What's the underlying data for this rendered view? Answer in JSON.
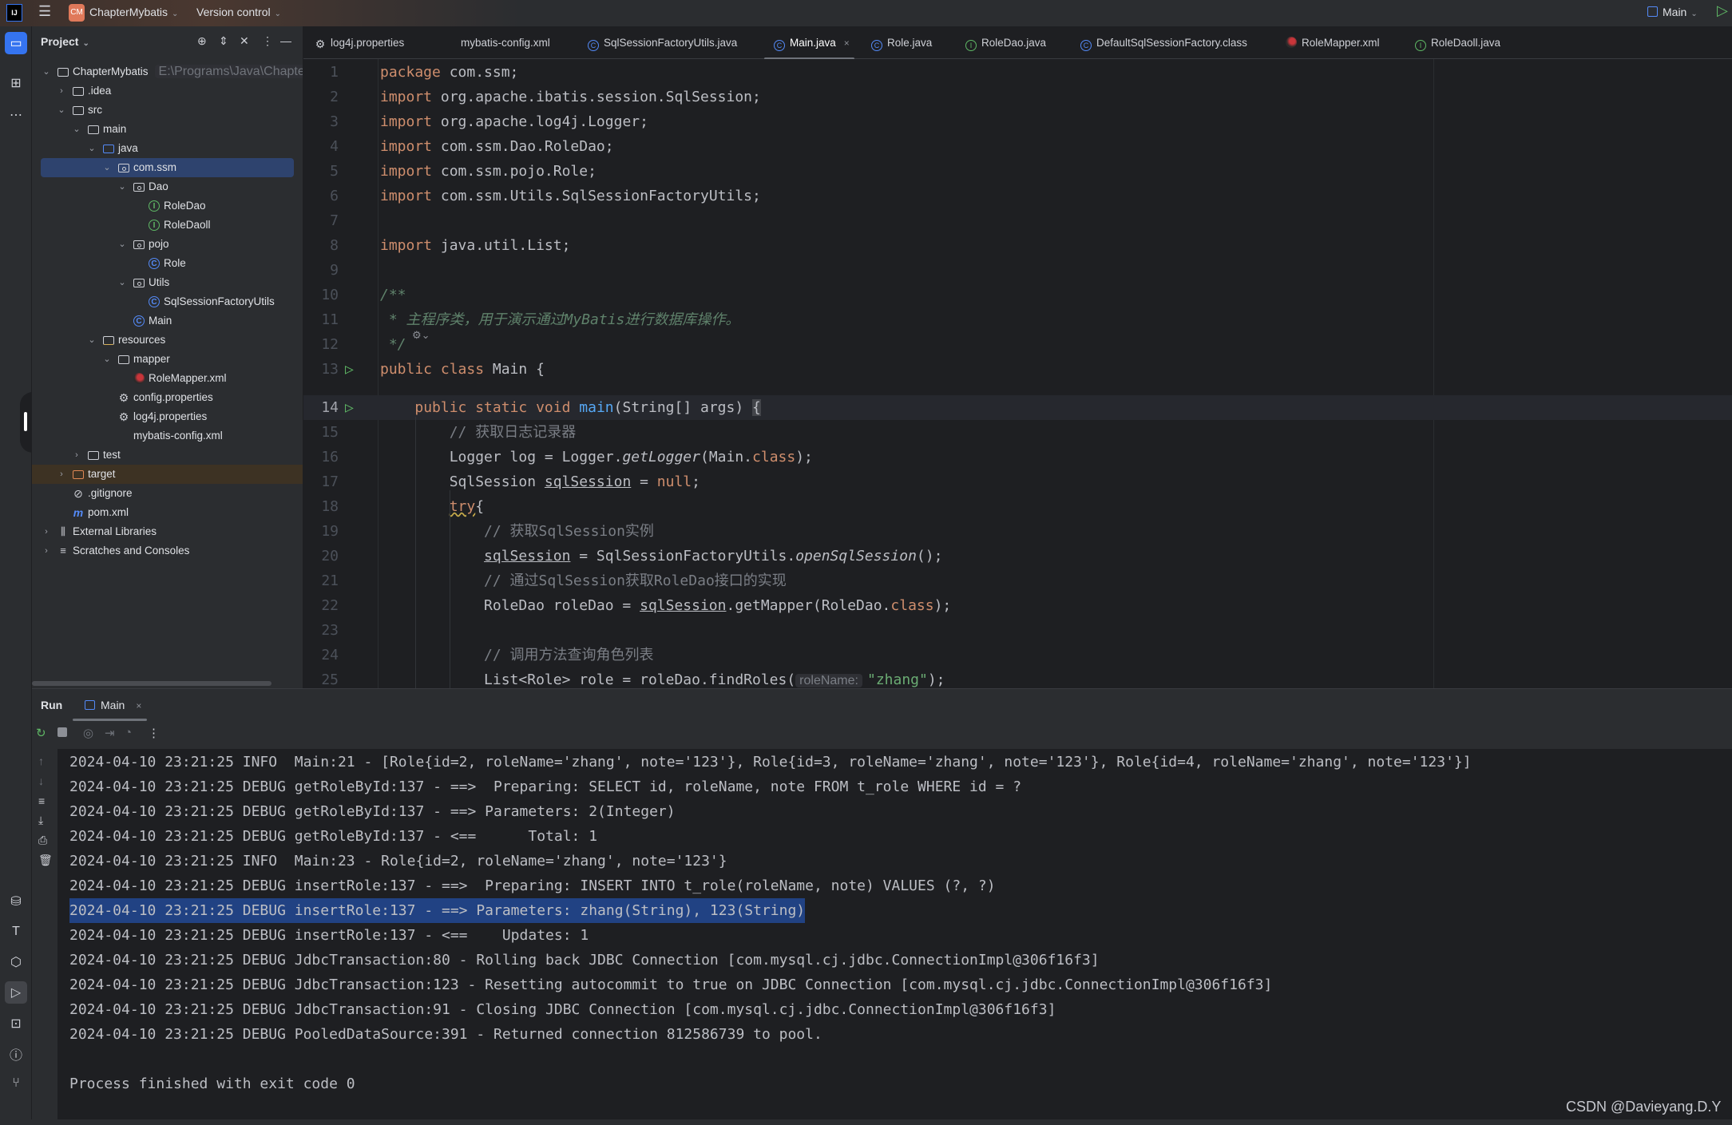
{
  "titlebar": {
    "app_logo": "IJ",
    "project_badge": "CM",
    "project_name": "ChapterMybatis",
    "vcs": "Version control",
    "run_config": "Main",
    "badge_color": "#e0795a"
  },
  "project_panel": {
    "title": "Project",
    "tree": [
      {
        "label": "ChapterMybatis",
        "hint": "E:\\Programs\\Java\\ChapterMy",
        "level": 0,
        "icon": "module-folder",
        "state": "expanded"
      },
      {
        "label": ".idea",
        "level": 1,
        "icon": "folder",
        "state": "collapsed"
      },
      {
        "label": "src",
        "level": 1,
        "icon": "folder",
        "state": "expanded"
      },
      {
        "label": "main",
        "level": 2,
        "icon": "folder",
        "state": "expanded"
      },
      {
        "label": "java",
        "level": 3,
        "icon": "source-folder",
        "state": "expanded"
      },
      {
        "label": "com.ssm",
        "level": 4,
        "icon": "package",
        "state": "expanded",
        "selected": true
      },
      {
        "label": "Dao",
        "level": 5,
        "icon": "package",
        "state": "expanded"
      },
      {
        "label": "RoleDao",
        "level": 6,
        "icon": "interface"
      },
      {
        "label": "RoleDaoll",
        "level": 6,
        "icon": "interface"
      },
      {
        "label": "pojo",
        "level": 5,
        "icon": "package",
        "state": "expanded"
      },
      {
        "label": "Role",
        "level": 6,
        "icon": "class"
      },
      {
        "label": "Utils",
        "level": 5,
        "icon": "package",
        "state": "expanded"
      },
      {
        "label": "SqlSessionFactoryUtils",
        "level": 6,
        "icon": "class"
      },
      {
        "label": "Main",
        "level": 5,
        "icon": "class"
      },
      {
        "label": "resources",
        "level": 3,
        "icon": "resources-folder",
        "state": "expanded"
      },
      {
        "label": "mapper",
        "level": 4,
        "icon": "folder",
        "state": "expanded"
      },
      {
        "label": "RoleMapper.xml",
        "level": 5,
        "icon": "mybatis"
      },
      {
        "label": "config.properties",
        "level": 4,
        "icon": "gear"
      },
      {
        "label": "log4j.properties",
        "level": 4,
        "icon": "gear"
      },
      {
        "label": "mybatis-config.xml",
        "level": 4,
        "icon": "xml"
      },
      {
        "label": "test",
        "level": 2,
        "icon": "folder",
        "state": "collapsed"
      },
      {
        "label": "target",
        "level": 1,
        "icon": "excluded-folder",
        "state": "collapsed",
        "highlighted": true
      },
      {
        "label": ".gitignore",
        "level": 1,
        "icon": "ignore"
      },
      {
        "label": "pom.xml",
        "level": 1,
        "icon": "maven"
      },
      {
        "label": "External Libraries",
        "level": 0,
        "icon": "library",
        "state": "collapsed"
      },
      {
        "label": "Scratches and Consoles",
        "level": 0,
        "icon": "scratches",
        "state": "collapsed"
      }
    ]
  },
  "tabs": [
    {
      "label": "log4j.properties",
      "icon": "gear"
    },
    {
      "label": "mybatis-config.xml",
      "icon": "xml"
    },
    {
      "label": "SqlSessionFactoryUtils.java",
      "icon": "class"
    },
    {
      "label": "Main.java",
      "icon": "class",
      "active": true,
      "close": "×"
    },
    {
      "label": "Role.java",
      "icon": "class"
    },
    {
      "label": "RoleDao.java",
      "icon": "interface"
    },
    {
      "label": "DefaultSqlSessionFactory.class",
      "icon": "class"
    },
    {
      "label": "RoleMapper.xml",
      "icon": "mybatis"
    },
    {
      "label": "RoleDaoll.java",
      "icon": "interface"
    }
  ],
  "editor": {
    "current_line": 14,
    "run_gutter_lines": [
      13,
      14
    ],
    "lines": [
      {
        "n": "1",
        "tokens": [
          {
            "t": "package",
            "c": "kw"
          },
          {
            "t": " com.ssm;"
          }
        ]
      },
      {
        "n": "2",
        "tokens": [
          {
            "t": "import",
            "c": "kw"
          },
          {
            "t": " org.apache.ibatis.session.SqlSession;"
          }
        ]
      },
      {
        "n": "3",
        "tokens": [
          {
            "t": "import",
            "c": "kw"
          },
          {
            "t": " org.apache.log4j.Logger;"
          }
        ]
      },
      {
        "n": "4",
        "tokens": [
          {
            "t": "import",
            "c": "kw"
          },
          {
            "t": " com.ssm.Dao.RoleDao;"
          }
        ]
      },
      {
        "n": "5",
        "tokens": [
          {
            "t": "import",
            "c": "kw"
          },
          {
            "t": " com.ssm.pojo.Role;"
          }
        ]
      },
      {
        "n": "6",
        "tokens": [
          {
            "t": "import",
            "c": "kw"
          },
          {
            "t": " com.ssm.Utils.SqlSessionFactoryUtils;"
          }
        ]
      },
      {
        "n": "7",
        "tokens": []
      },
      {
        "n": "8",
        "tokens": [
          {
            "t": "import",
            "c": "kw"
          },
          {
            "t": " java.util.List;"
          }
        ]
      },
      {
        "n": "9",
        "tokens": []
      },
      {
        "n": "10",
        "tokens": [
          {
            "t": "/**",
            "c": "doc"
          }
        ]
      },
      {
        "n": "11",
        "tokens": [
          {
            "t": " * 主程序类，用于演示通过MyBatis进行数据库操作。",
            "c": "doc"
          }
        ]
      },
      {
        "n": "12",
        "tokens": [
          {
            "t": " */",
            "c": "doc"
          }
        ]
      },
      {
        "n": "13",
        "tokens": [
          {
            "t": "public class",
            "c": "kw"
          },
          {
            "t": " Main {"
          }
        ]
      },
      {
        "n": "14",
        "tokens": [
          {
            "t": "    "
          },
          {
            "t": "public static void",
            "c": "kw"
          },
          {
            "t": " "
          },
          {
            "t": "main",
            "c": "fn"
          },
          {
            "t": "(String[] args) "
          },
          {
            "t": "{",
            "c": "brace"
          }
        ]
      },
      {
        "n": "15",
        "tokens": [
          {
            "t": "        "
          },
          {
            "t": "// 获取日志记录器",
            "c": "cm"
          }
        ]
      },
      {
        "n": "16",
        "tokens": [
          {
            "t": "        Logger log = Logger."
          },
          {
            "t": "getLogger",
            "c": "it"
          },
          {
            "t": "(Main."
          },
          {
            "t": "class",
            "c": "kw"
          },
          {
            "t": ");"
          }
        ]
      },
      {
        "n": "17",
        "tokens": [
          {
            "t": "        SqlSession "
          },
          {
            "t": "sqlSession",
            "c": "ul"
          },
          {
            "t": " = "
          },
          {
            "t": "null",
            "c": "kw"
          },
          {
            "t": ";"
          }
        ]
      },
      {
        "n": "18",
        "tokens": [
          {
            "t": "        "
          },
          {
            "t": "try",
            "c": "warn"
          },
          {
            "t": "{"
          }
        ]
      },
      {
        "n": "19",
        "tokens": [
          {
            "t": "            "
          },
          {
            "t": "// 获取SqlSession实例",
            "c": "cm"
          }
        ]
      },
      {
        "n": "20",
        "tokens": [
          {
            "t": "            "
          },
          {
            "t": "sqlSession",
            "c": "ul"
          },
          {
            "t": " = SqlSessionFactoryUtils."
          },
          {
            "t": "openSqlSession",
            "c": "it"
          },
          {
            "t": "();"
          }
        ]
      },
      {
        "n": "21",
        "tokens": [
          {
            "t": "            "
          },
          {
            "t": "// 通过SqlSession获取RoleDao接口的实现",
            "c": "cm"
          }
        ]
      },
      {
        "n": "22",
        "tokens": [
          {
            "t": "            RoleDao roleDao = "
          },
          {
            "t": "sqlSession",
            "c": "ul"
          },
          {
            "t": ".getMapper(RoleDao."
          },
          {
            "t": "class",
            "c": "kw"
          },
          {
            "t": ");"
          }
        ]
      },
      {
        "n": "23",
        "tokens": []
      },
      {
        "n": "24",
        "tokens": [
          {
            "t": "            "
          },
          {
            "t": "// 调用方法查询角色列表",
            "c": "cm"
          }
        ]
      },
      {
        "n": "25",
        "tokens": [
          {
            "t": "            List<Role> role = roleDao.findRoles("
          },
          {
            "t": "roleName:",
            "c": "hint"
          },
          {
            "t": "\"zhang\"",
            "c": "str"
          },
          {
            "t": ");"
          }
        ]
      }
    ]
  },
  "run_panel": {
    "title": "Run",
    "tab": "Main",
    "tab_close": "×",
    "highlighted_line": 6,
    "lines": [
      "2024-04-10 23:21:25 INFO  Main:21 - [Role{id=2, roleName='zhang', note='123'}, Role{id=3, roleName='zhang', note='123'}, Role{id=4, roleName='zhang', note='123'}]",
      "2024-04-10 23:21:25 DEBUG getRoleById:137 - ==>  Preparing: SELECT id, roleName, note FROM t_role WHERE id = ?",
      "2024-04-10 23:21:25 DEBUG getRoleById:137 - ==> Parameters: 2(Integer)",
      "2024-04-10 23:21:25 DEBUG getRoleById:137 - <==      Total: 1",
      "2024-04-10 23:21:25 INFO  Main:23 - Role{id=2, roleName='zhang', note='123'}",
      "2024-04-10 23:21:25 DEBUG insertRole:137 - ==>  Preparing: INSERT INTO t_role(roleName, note) VALUES (?, ?)",
      "2024-04-10 23:21:25 DEBUG insertRole:137 - ==> Parameters: zhang(String), 123(String)",
      "2024-04-10 23:21:25 DEBUG insertRole:137 - <==    Updates: 1",
      "2024-04-10 23:21:25 DEBUG JdbcTransaction:80 - Rolling back JDBC Connection [com.mysql.cj.jdbc.ConnectionImpl@306f16f3]",
      "2024-04-10 23:21:25 DEBUG JdbcTransaction:123 - Resetting autocommit to true on JDBC Connection [com.mysql.cj.jdbc.ConnectionImpl@306f16f3]",
      "2024-04-10 23:21:25 DEBUG JdbcTransaction:91 - Closing JDBC Connection [com.mysql.cj.jdbc.ConnectionImpl@306f16f3]",
      "2024-04-10 23:21:25 DEBUG PooledDataSource:391 - Returned connection 812586739 to pool.",
      "",
      "Process finished with exit code 0"
    ]
  },
  "watermark": "CSDN @Davieyang.D.Y"
}
